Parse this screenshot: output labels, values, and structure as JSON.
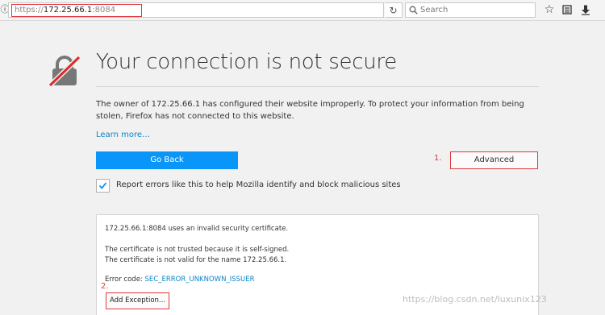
{
  "toolbar": {
    "url_protocol": "https://",
    "url_host": "172.25.66.1",
    "url_port": ":8084",
    "search_placeholder": "Search",
    "icons": [
      "info-icon",
      "dropdown-icon",
      "reload-icon",
      "search-icon",
      "bookmark-star-icon",
      "reading-list-icon",
      "downloads-icon"
    ]
  },
  "page": {
    "title": "Your connection is not secure",
    "description": "The owner of 172.25.66.1 has configured their website improperly. To protect your information from being stolen, Firefox has not connected to this website.",
    "learn_more": "Learn more…",
    "go_back_label": "Go Back",
    "advanced_label": "Advanced",
    "marker_1": "1.",
    "marker_2": "2.",
    "report_checkbox_label": "Report errors like this to help Mozilla identify and block malicious sites",
    "report_checkbox_checked": true
  },
  "advanced_panel": {
    "line1": "172.25.66.1:8084 uses an invalid security certificate.",
    "line2": "The certificate is not trusted because it is self-signed.",
    "line3": "The certificate is not valid for the name 172.25.66.1.",
    "error_code_label": "Error code: ",
    "error_code": "SEC_ERROR_UNKNOWN_ISSUER",
    "add_exception_label": "Add Exception..."
  },
  "watermark": "https://blog.csdn.net/luxunix123",
  "colors": {
    "accent_blue": "#0996f8",
    "link_blue": "#0a84c9",
    "annotation_red": "#e0393e",
    "page_background": "#f1f1f1"
  }
}
